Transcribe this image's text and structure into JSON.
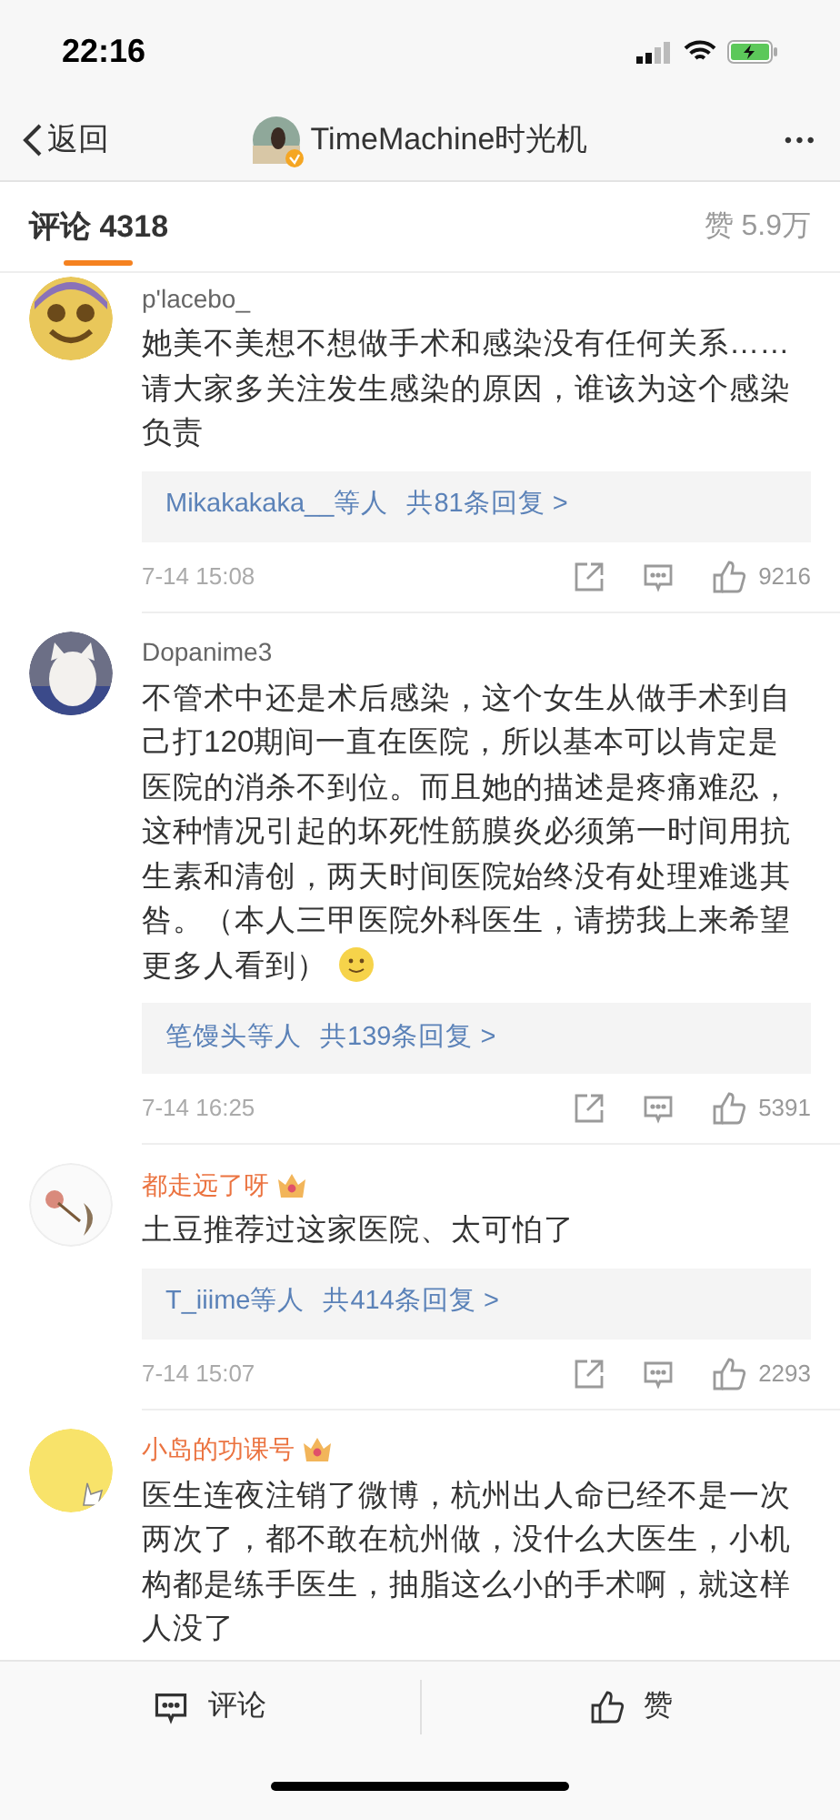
{
  "status_bar": {
    "time": "22:16"
  },
  "nav": {
    "back": "返回",
    "title": "TimeMachine时光机",
    "verified": true,
    "more": "•••"
  },
  "tabs": {
    "comments": "评论 4318",
    "likes": "赞 5.9万"
  },
  "comments": [
    {
      "name": "p'lacebo_",
      "vip": false,
      "text": "她美不美想不想做手术和感染没有任何关系……请大家多关注发生感染的原因，谁该为这个感染负责",
      "emoji": false,
      "replies": {
        "who": "Mikakakaka__等人",
        "count": "共81条回复 >"
      },
      "time": "7-14 15:08",
      "likes": "9216"
    },
    {
      "name": "Dopanime3",
      "vip": false,
      "text": "不管术中还是术后感染，这个女生从做手术到自己打120期间一直在医院，所以基本可以肯定是医院的消杀不到位。而且她的描述是疼痛难忍，这种情况引起的坏死性筋膜炎必须第一时间用抗生素和清创，两天时间医院始终没有处理难逃其咎。（本人三甲医院外科医生，请捞我上来希望更多人看到）",
      "emoji": true,
      "replies": {
        "who": "笔馒头等人",
        "count": "共139条回复 >"
      },
      "time": "7-14 16:25",
      "likes": "5391"
    },
    {
      "name": "都走远了呀",
      "vip": true,
      "text": "土豆推荐过这家医院、太可怕了",
      "emoji": false,
      "replies": {
        "who": "T_iiime等人",
        "count": "共414条回复 >"
      },
      "time": "7-14 15:07",
      "likes": "2293"
    },
    {
      "name": "小岛的功课号",
      "vip": true,
      "text": "医生连夜注销了微博，杭州出人命已经不是一次两次了，都不敢在杭州做，没什么大医生，小机构都是练手医生，抽脂这么小的手术啊，就这样人没了",
      "emoji": false
    }
  ],
  "bottom_bar": {
    "comment": "评论",
    "like": "赞"
  }
}
